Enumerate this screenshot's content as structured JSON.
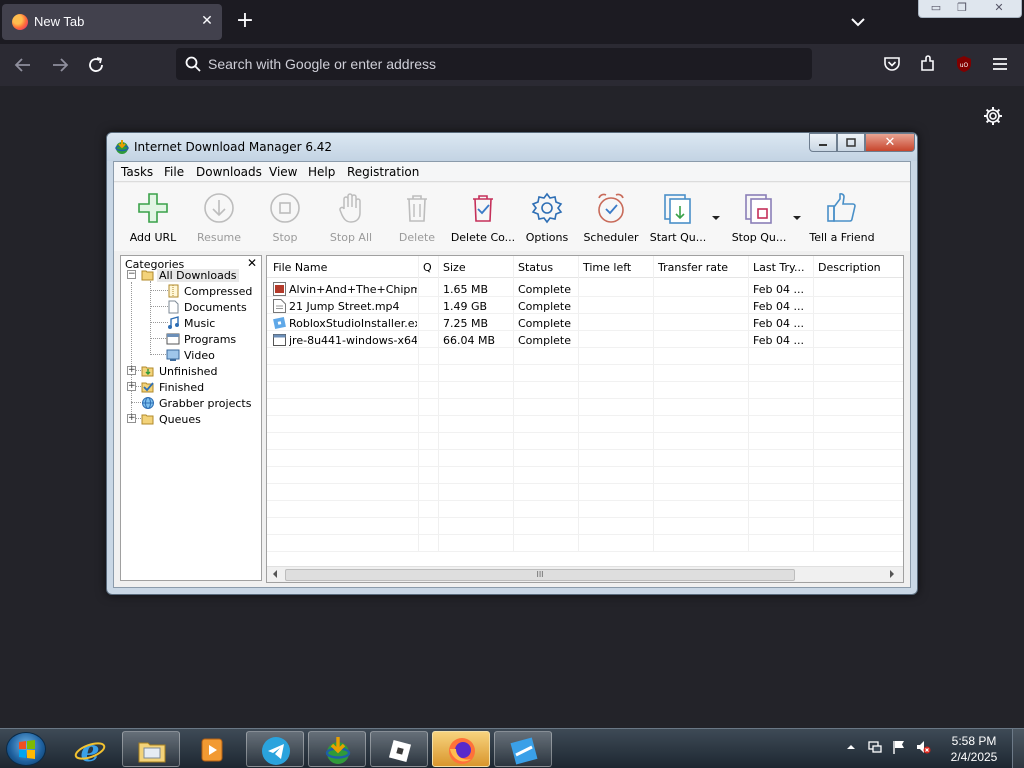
{
  "browser": {
    "tab_title": "New Tab",
    "url_placeholder": "Search with Google or enter address"
  },
  "idm": {
    "title": "Internet Download Manager 6.42",
    "menu": [
      "Tasks",
      "File",
      "Downloads",
      "View",
      "Help",
      "Registration"
    ],
    "toolbar": [
      {
        "label": "Add URL",
        "enabled": true,
        "icon": "add-url-icon"
      },
      {
        "label": "Resume",
        "enabled": false,
        "icon": "resume-icon"
      },
      {
        "label": "Stop",
        "enabled": false,
        "icon": "stop-icon"
      },
      {
        "label": "Stop All",
        "enabled": false,
        "icon": "stop-all-icon"
      },
      {
        "label": "Delete",
        "enabled": false,
        "icon": "delete-icon"
      },
      {
        "label": "Delete Co...",
        "enabled": true,
        "icon": "delete-completed-icon"
      },
      {
        "label": "Options",
        "enabled": true,
        "icon": "options-icon"
      },
      {
        "label": "Scheduler",
        "enabled": true,
        "icon": "scheduler-icon"
      },
      {
        "label": "Start Qu...",
        "enabled": true,
        "icon": "start-queue-icon"
      },
      {
        "label": "Stop Qu...",
        "enabled": true,
        "icon": "stop-queue-icon"
      },
      {
        "label": "Tell a Friend",
        "enabled": true,
        "icon": "tell-a-friend-icon"
      }
    ],
    "categories": {
      "header": "Categories",
      "items": [
        {
          "label": "All Downloads",
          "icon": "folder-open-icon",
          "selected": true
        },
        {
          "label": "Compressed",
          "icon": "zip-icon"
        },
        {
          "label": "Documents",
          "icon": "document-icon"
        },
        {
          "label": "Music",
          "icon": "music-icon"
        },
        {
          "label": "Programs",
          "icon": "program-icon"
        },
        {
          "label": "Video",
          "icon": "video-icon"
        },
        {
          "label": "Unfinished",
          "icon": "folder-unfinished-icon"
        },
        {
          "label": "Finished",
          "icon": "folder-finished-icon"
        },
        {
          "label": "Grabber projects",
          "icon": "grabber-icon"
        },
        {
          "label": "Queues",
          "icon": "folder-icon"
        }
      ]
    },
    "columns": [
      "File Name",
      "Q",
      "Size",
      "Status",
      "Time left",
      "Transfer rate",
      "Last Try...",
      "Description"
    ],
    "rows": [
      {
        "name": "Alvin+And+The+Chipm...",
        "size": "1.65  MB",
        "status": "Complete",
        "last_try": "Feb 04 ...",
        "icon": "video-file-icon"
      },
      {
        "name": "21 Jump Street.mp4",
        "size": "1.49  GB",
        "status": "Complete",
        "last_try": "Feb 04 ...",
        "icon": "file-icon"
      },
      {
        "name": "RobloxStudioInstaller.exe",
        "size": "7.25  MB",
        "status": "Complete",
        "last_try": "Feb 04 ...",
        "icon": "roblox-icon"
      },
      {
        "name": "jre-8u441-windows-x64....",
        "size": "66.04  MB",
        "status": "Complete",
        "last_try": "Feb 04 ...",
        "icon": "exe-icon"
      }
    ],
    "scroll_grip": "III"
  },
  "taskbar": {
    "time": "5:58 PM",
    "date": "2/4/2025"
  }
}
